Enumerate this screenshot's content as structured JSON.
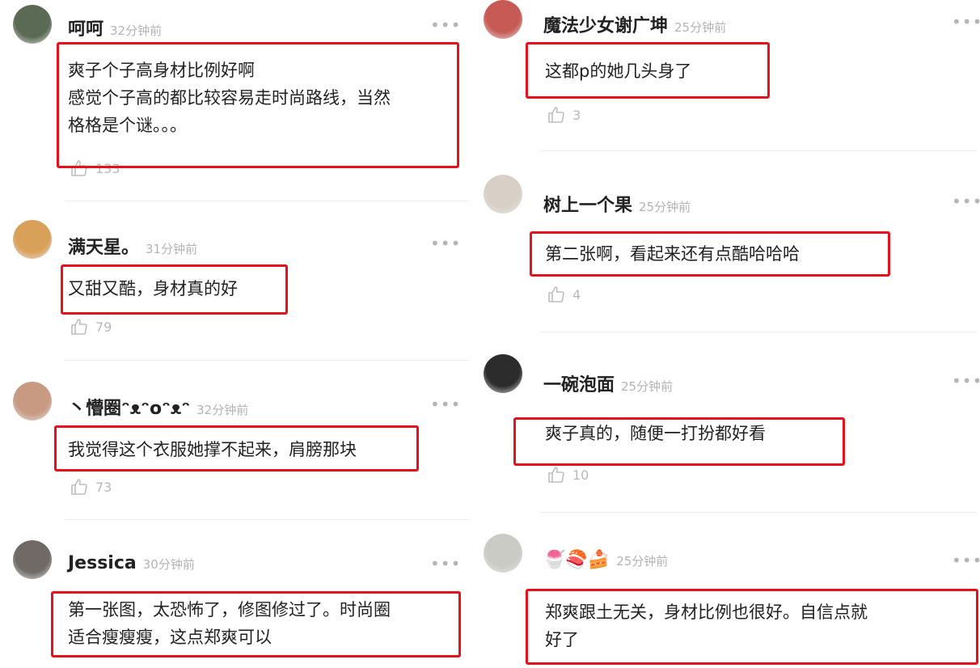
{
  "left": [
    {
      "user": "呵呵",
      "time": "32分钟前",
      "text": [
        "爽子个子高身材比例好啊",
        "感觉个子高的都比较容易走时尚路线，当然",
        "格格是个谜。。。"
      ],
      "likes": "133",
      "avatar_color": "#5a6a55"
    },
    {
      "user": "满天星。",
      "time": "31分钟前",
      "text": [
        "又甜又酷，身材真的好"
      ],
      "likes": "79",
      "avatar_color": "#d9a05a"
    },
    {
      "user": "丶懵圈ᵔᴥᵔoᵔᴥᵔ",
      "time": "32分钟前",
      "text": [
        "我觉得这个衣服她撑不起来，肩膀那块"
      ],
      "likes": "73",
      "avatar_color": "#c89a82"
    },
    {
      "user": "Jessica",
      "time": "30分钟前",
      "text": [
        "第一张图，太恐怖了，修图修过了。时尚圈",
        "适合瘦瘦瘦，这点郑爽可以"
      ],
      "likes": "",
      "avatar_color": "#6f6a66"
    }
  ],
  "right": [
    {
      "user": "魔法少女谢广坤",
      "time": "25分钟前",
      "text": [
        "这都p的她几头身了"
      ],
      "likes": "3",
      "avatar_color": "#c75a55"
    },
    {
      "user": "树上一个果",
      "time": "25分钟前",
      "text": [
        "第二张啊，看起来还有点酷哈哈哈"
      ],
      "likes": "4",
      "avatar_color": "#d8cfc6"
    },
    {
      "user": "一碗泡面",
      "time": "25分钟前",
      "text": [
        "爽子真的，随便一打扮都好看"
      ],
      "likes": "10",
      "avatar_color": "#2c2c2c"
    },
    {
      "user": "🍧🍣🍰",
      "time": "25分钟前",
      "text": [
        "郑爽跟土无关，身材比例也很好。自信点就",
        "好了"
      ],
      "likes": "",
      "avatar_color": "#c9cbc4"
    }
  ],
  "more_label": "•••",
  "accent_red": "#e8101a"
}
